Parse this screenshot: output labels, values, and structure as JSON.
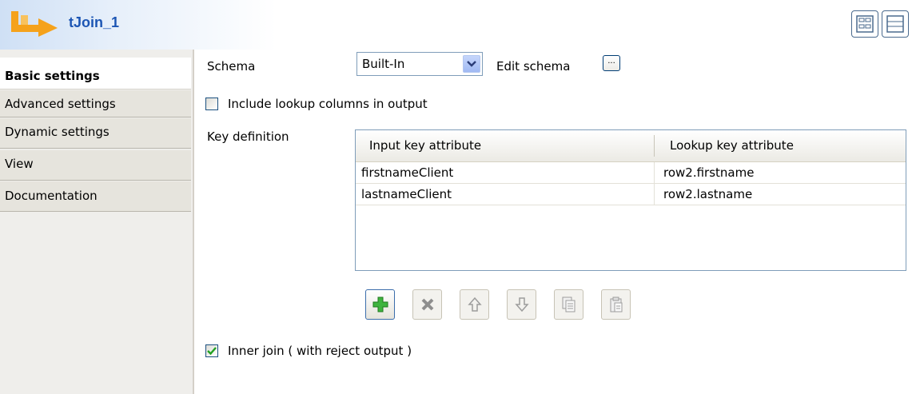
{
  "header": {
    "title": "tJoin_1"
  },
  "sidebar": {
    "tabs": [
      {
        "label": "Basic settings",
        "active": true
      },
      {
        "label": "Advanced settings",
        "active": false
      },
      {
        "label": "Dynamic settings",
        "active": false
      },
      {
        "label": "View",
        "active": false
      },
      {
        "label": "Documentation",
        "active": false
      }
    ]
  },
  "form": {
    "schema_label": "Schema",
    "schema_value": "Built-In",
    "edit_schema_label": "Edit schema",
    "edit_schema_button": "...",
    "include_lookup": {
      "label": "Include lookup columns in output",
      "checked": false
    },
    "key_definition_label": "Key definition",
    "key_table": {
      "columns": [
        "Input key attribute",
        "Lookup key attribute"
      ],
      "rows": [
        [
          "firstnameClient",
          "row2.firstname"
        ],
        [
          "lastnameClient",
          "row2.lastname"
        ]
      ]
    },
    "inner_join": {
      "label": "Inner join ( with reject output )",
      "checked": true
    }
  },
  "toolbar": {
    "buttons": [
      {
        "icon": "add-icon",
        "enabled": true
      },
      {
        "icon": "delete-icon",
        "enabled": false
      },
      {
        "icon": "move-up-icon",
        "enabled": false
      },
      {
        "icon": "move-down-icon",
        "enabled": false
      },
      {
        "icon": "copy-icon",
        "enabled": false
      },
      {
        "icon": "paste-icon",
        "enabled": false
      }
    ]
  },
  "colors": {
    "title": "#1d56b4",
    "accent_orange": "#f5a21b",
    "check": "#21a121",
    "add_green": "#3fb43f"
  }
}
